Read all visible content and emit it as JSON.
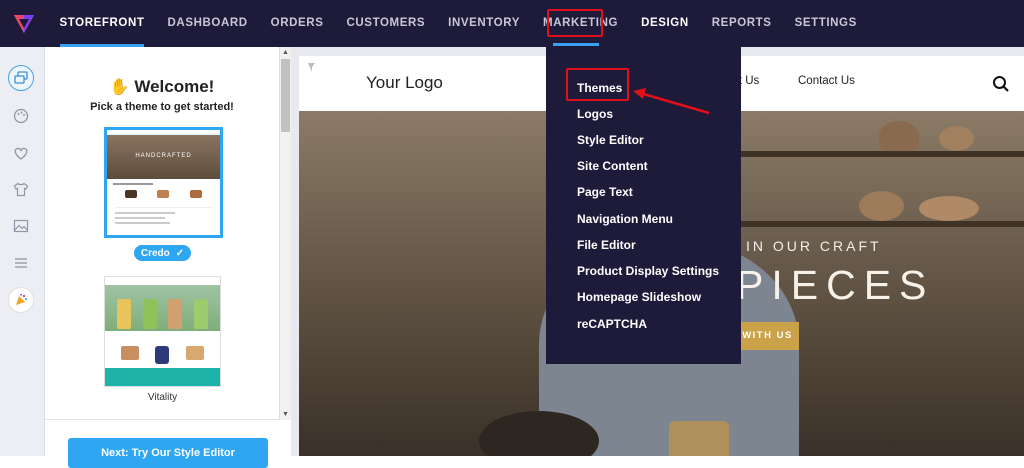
{
  "nav": {
    "items": [
      {
        "label": "STOREFRONT"
      },
      {
        "label": "DASHBOARD"
      },
      {
        "label": "ORDERS"
      },
      {
        "label": "CUSTOMERS"
      },
      {
        "label": "INVENTORY"
      },
      {
        "label": "MARKETING"
      },
      {
        "label": "DESIGN"
      },
      {
        "label": "REPORTS"
      },
      {
        "label": "SETTINGS"
      }
    ]
  },
  "panel": {
    "welcome": "Welcome!",
    "pick": "Pick a theme to get started!",
    "theme1_name": "Credo",
    "theme1_header": "HANDCRAFTED",
    "theme2_name": "Vitality",
    "cta": "Next: Try Our Style Editor"
  },
  "preview": {
    "logo": "Your Logo",
    "links": [
      "About Us",
      "Contact Us"
    ],
    "hero_line1": "IN OUR CRAFT",
    "hero_line2": "PIECES",
    "hero_button": "WITH US"
  },
  "dropdown": {
    "items": [
      {
        "label": "Themes"
      },
      {
        "label": "Logos"
      },
      {
        "label": "Style Editor"
      },
      {
        "label": "Site Content"
      },
      {
        "label": "Page Text"
      },
      {
        "label": "Navigation Menu"
      },
      {
        "label": "File Editor"
      },
      {
        "label": "Product Display Settings"
      },
      {
        "label": "Homepage Slideshow"
      },
      {
        "label": "reCAPTCHA"
      }
    ]
  },
  "colors": {
    "nav_bg": "#1e1a3a",
    "accent": "#2fa6f2",
    "highlight": "#e0101a",
    "hero_button": "#c9a24a"
  }
}
